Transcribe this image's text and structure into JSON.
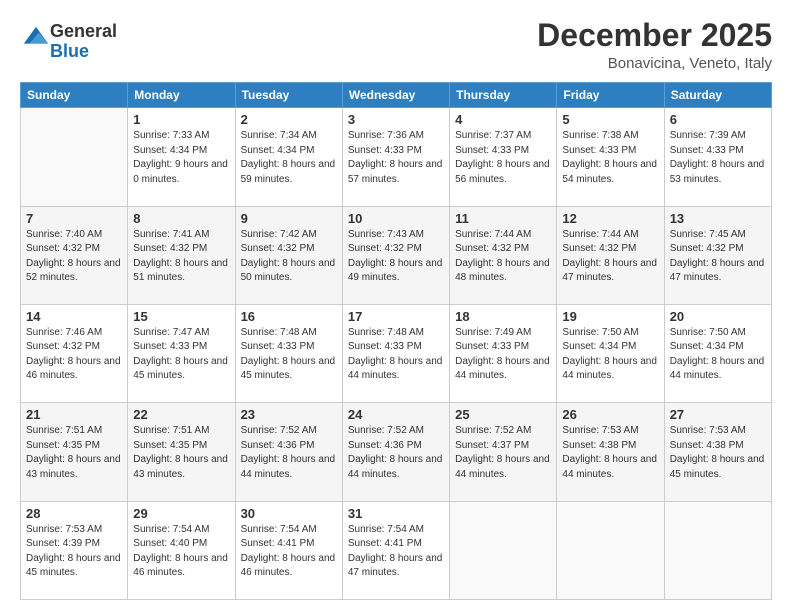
{
  "header": {
    "logo": {
      "line1": "General",
      "line2": "Blue"
    },
    "title": "December 2025",
    "location": "Bonavicina, Veneto, Italy"
  },
  "weekdays": [
    "Sunday",
    "Monday",
    "Tuesday",
    "Wednesday",
    "Thursday",
    "Friday",
    "Saturday"
  ],
  "weeks": [
    [
      {
        "day": "",
        "empty": true
      },
      {
        "day": "1",
        "sunrise": "7:33 AM",
        "sunset": "4:34 PM",
        "daylight": "9 hours and 0 minutes."
      },
      {
        "day": "2",
        "sunrise": "7:34 AM",
        "sunset": "4:34 PM",
        "daylight": "8 hours and 59 minutes."
      },
      {
        "day": "3",
        "sunrise": "7:36 AM",
        "sunset": "4:33 PM",
        "daylight": "8 hours and 57 minutes."
      },
      {
        "day": "4",
        "sunrise": "7:37 AM",
        "sunset": "4:33 PM",
        "daylight": "8 hours and 56 minutes."
      },
      {
        "day": "5",
        "sunrise": "7:38 AM",
        "sunset": "4:33 PM",
        "daylight": "8 hours and 54 minutes."
      },
      {
        "day": "6",
        "sunrise": "7:39 AM",
        "sunset": "4:33 PM",
        "daylight": "8 hours and 53 minutes."
      }
    ],
    [
      {
        "day": "7",
        "sunrise": "7:40 AM",
        "sunset": "4:32 PM",
        "daylight": "8 hours and 52 minutes."
      },
      {
        "day": "8",
        "sunrise": "7:41 AM",
        "sunset": "4:32 PM",
        "daylight": "8 hours and 51 minutes."
      },
      {
        "day": "9",
        "sunrise": "7:42 AM",
        "sunset": "4:32 PM",
        "daylight": "8 hours and 50 minutes."
      },
      {
        "day": "10",
        "sunrise": "7:43 AM",
        "sunset": "4:32 PM",
        "daylight": "8 hours and 49 minutes."
      },
      {
        "day": "11",
        "sunrise": "7:44 AM",
        "sunset": "4:32 PM",
        "daylight": "8 hours and 48 minutes."
      },
      {
        "day": "12",
        "sunrise": "7:44 AM",
        "sunset": "4:32 PM",
        "daylight": "8 hours and 47 minutes."
      },
      {
        "day": "13",
        "sunrise": "7:45 AM",
        "sunset": "4:32 PM",
        "daylight": "8 hours and 47 minutes."
      }
    ],
    [
      {
        "day": "14",
        "sunrise": "7:46 AM",
        "sunset": "4:32 PM",
        "daylight": "8 hours and 46 minutes."
      },
      {
        "day": "15",
        "sunrise": "7:47 AM",
        "sunset": "4:33 PM",
        "daylight": "8 hours and 45 minutes."
      },
      {
        "day": "16",
        "sunrise": "7:48 AM",
        "sunset": "4:33 PM",
        "daylight": "8 hours and 45 minutes."
      },
      {
        "day": "17",
        "sunrise": "7:48 AM",
        "sunset": "4:33 PM",
        "daylight": "8 hours and 44 minutes."
      },
      {
        "day": "18",
        "sunrise": "7:49 AM",
        "sunset": "4:33 PM",
        "daylight": "8 hours and 44 minutes."
      },
      {
        "day": "19",
        "sunrise": "7:50 AM",
        "sunset": "4:34 PM",
        "daylight": "8 hours and 44 minutes."
      },
      {
        "day": "20",
        "sunrise": "7:50 AM",
        "sunset": "4:34 PM",
        "daylight": "8 hours and 44 minutes."
      }
    ],
    [
      {
        "day": "21",
        "sunrise": "7:51 AM",
        "sunset": "4:35 PM",
        "daylight": "8 hours and 43 minutes."
      },
      {
        "day": "22",
        "sunrise": "7:51 AM",
        "sunset": "4:35 PM",
        "daylight": "8 hours and 43 minutes."
      },
      {
        "day": "23",
        "sunrise": "7:52 AM",
        "sunset": "4:36 PM",
        "daylight": "8 hours and 44 minutes."
      },
      {
        "day": "24",
        "sunrise": "7:52 AM",
        "sunset": "4:36 PM",
        "daylight": "8 hours and 44 minutes."
      },
      {
        "day": "25",
        "sunrise": "7:52 AM",
        "sunset": "4:37 PM",
        "daylight": "8 hours and 44 minutes."
      },
      {
        "day": "26",
        "sunrise": "7:53 AM",
        "sunset": "4:38 PM",
        "daylight": "8 hours and 44 minutes."
      },
      {
        "day": "27",
        "sunrise": "7:53 AM",
        "sunset": "4:38 PM",
        "daylight": "8 hours and 45 minutes."
      }
    ],
    [
      {
        "day": "28",
        "sunrise": "7:53 AM",
        "sunset": "4:39 PM",
        "daylight": "8 hours and 45 minutes."
      },
      {
        "day": "29",
        "sunrise": "7:54 AM",
        "sunset": "4:40 PM",
        "daylight": "8 hours and 46 minutes."
      },
      {
        "day": "30",
        "sunrise": "7:54 AM",
        "sunset": "4:41 PM",
        "daylight": "8 hours and 46 minutes."
      },
      {
        "day": "31",
        "sunrise": "7:54 AM",
        "sunset": "4:41 PM",
        "daylight": "8 hours and 47 minutes."
      },
      {
        "day": "",
        "empty": true
      },
      {
        "day": "",
        "empty": true
      },
      {
        "day": "",
        "empty": true
      }
    ]
  ],
  "labels": {
    "sunrise": "Sunrise: ",
    "sunset": "Sunset: ",
    "daylight": "Daylight: "
  }
}
